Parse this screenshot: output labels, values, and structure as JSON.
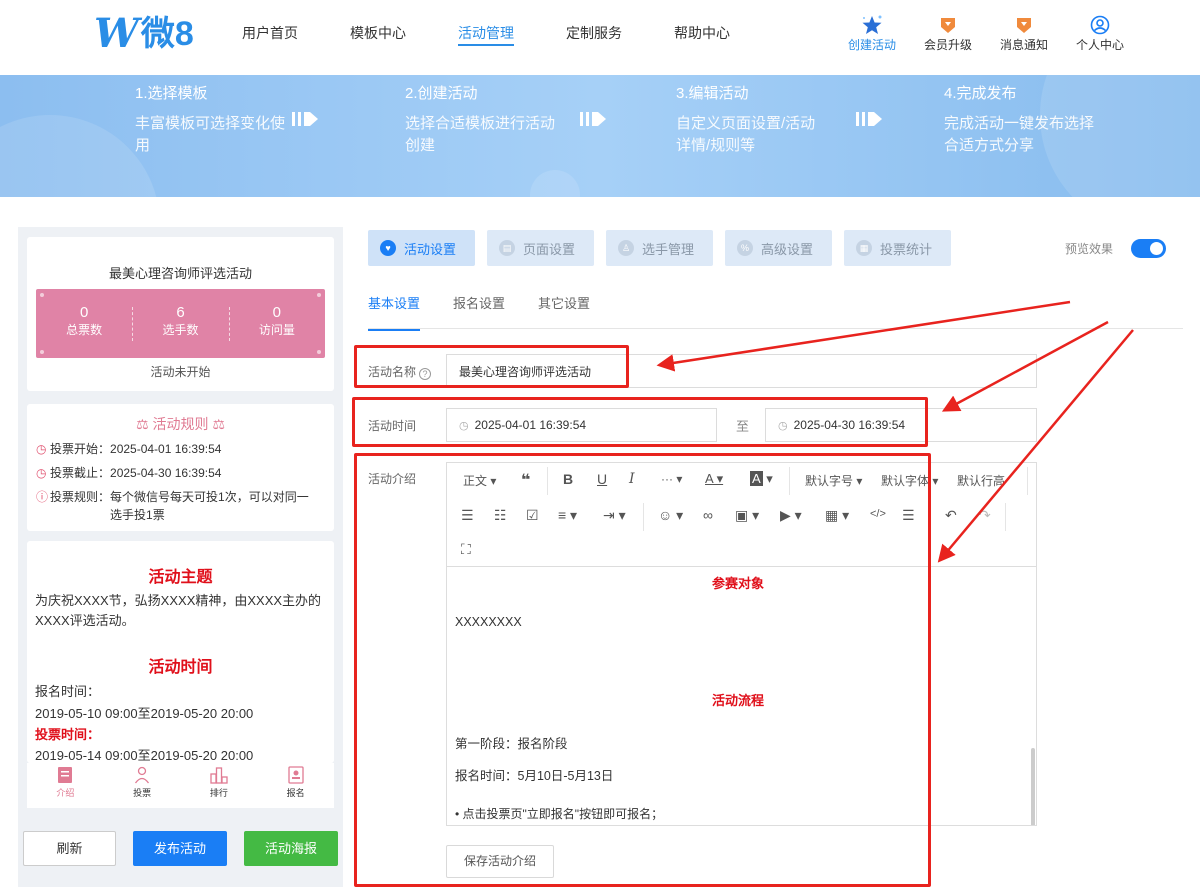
{
  "header": {
    "logo_mark": "W",
    "logo_text": "微8",
    "nav": [
      "用户首页",
      "模板中心",
      "活动管理",
      "定制服务",
      "帮助中心"
    ],
    "tools": [
      {
        "label": "创建活动",
        "icon": "star-icon"
      },
      {
        "label": "会员升级",
        "icon": "member-upgrade-icon"
      },
      {
        "label": "消息通知",
        "icon": "notification-icon"
      },
      {
        "label": "个人中心",
        "icon": "user-profile-icon"
      }
    ]
  },
  "banner": {
    "steps": [
      {
        "title": "1.选择模板",
        "desc": "丰富模板可选择变化使用"
      },
      {
        "title": "2.创建活动",
        "desc": "选择合适模板进行活动创建"
      },
      {
        "title": "3.编辑活动",
        "desc": "自定义页面设置/活动详情/规则等"
      },
      {
        "title": "4.完成发布",
        "desc": "完成活动一键发布选择合适方式分享"
      }
    ]
  },
  "preview": {
    "title": "最美心理咨询师评选活动",
    "stats": [
      {
        "value": "0",
        "label": "总票数"
      },
      {
        "value": "6",
        "label": "选手数"
      },
      {
        "value": "0",
        "label": "访问量"
      }
    ],
    "status": "活动未开始",
    "rules_title": "活动规则",
    "rules": [
      {
        "label": "投票开始：",
        "value": "2025-04-01 16:39:54"
      },
      {
        "label": "投票截止：",
        "value": "2025-04-30 16:39:54"
      },
      {
        "label": "投票规则：",
        "value": "每个微信号每天可投1次，可以对同一选手投1票"
      }
    ],
    "theme_title": "活动主题",
    "theme_text": "为庆祝XXXX节，弘扬XXXX精神，由XXXX主办的XXXX评选活动。",
    "time_title": "活动时间",
    "signup_label": "报名时间：",
    "signup_value": "2019-05-10 09:00至2019-05-20 20:00",
    "vote_label": "投票时间：",
    "vote_value": "2019-05-14 09:00至2019-05-20 20:00",
    "tabbar": [
      "介绍",
      "投票",
      "排行",
      "报名"
    ]
  },
  "buttons": {
    "refresh": "刷新",
    "publish": "发布活动",
    "poster": "活动海报"
  },
  "tabs": [
    "活动设置",
    "页面设置",
    "选手管理",
    "高级设置",
    "投票统计"
  ],
  "preview_toggle": {
    "label": "预览效果",
    "on": true
  },
  "subtabs": [
    "基本设置",
    "报名设置",
    "其它设置"
  ],
  "form": {
    "name_label": "活动名称",
    "name_value": "最美心理咨询师评选活动",
    "time_label": "活动时间",
    "start": "2025-04-01 16:39:54",
    "to": "至",
    "end": "2025-04-30 16:39:54",
    "intro_label": "活动介绍"
  },
  "editor": {
    "toolbar_row1": [
      "正文",
      "❝",
      "B",
      "U",
      "I",
      "···",
      "A",
      "A",
      "默认字号",
      "默认字体",
      "默认行高"
    ],
    "content": {
      "heading1": "参赛对象",
      "line1": "XXXXXXXX",
      "heading2": "活动流程",
      "line2": "第一阶段：报名阶段",
      "line3": "报名时间：5月10日-5月13日",
      "line4": "点击投票页\"立即报名\"按钮即可报名；"
    }
  },
  "save_label": "保存活动介绍",
  "colors": {
    "accent": "#1a7ef5",
    "stats_bg": "#e083a6",
    "highlight": "#e8231e",
    "banner": "#a6d0f7"
  }
}
